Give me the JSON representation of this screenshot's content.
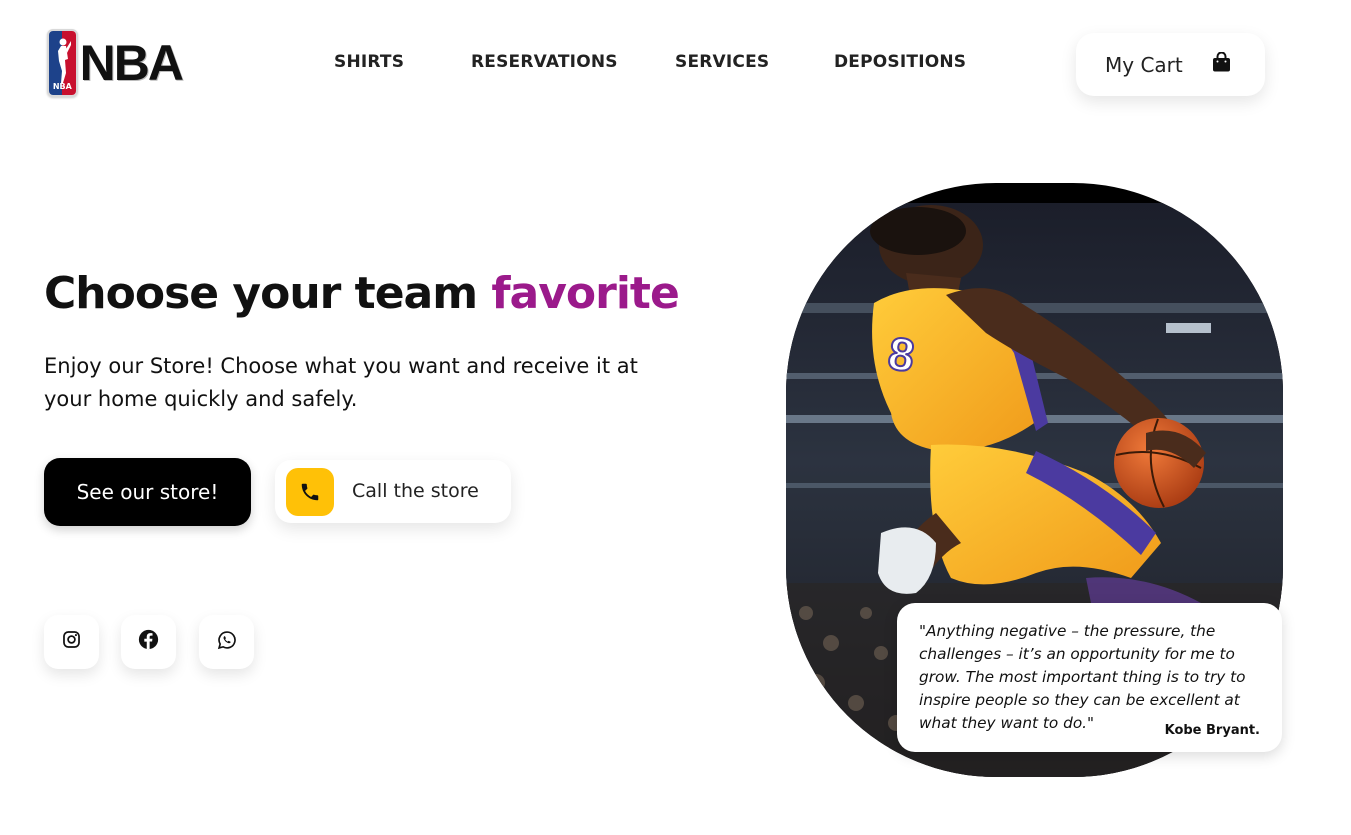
{
  "brand": {
    "logo_text": "NBA",
    "mark_text": "NBA"
  },
  "nav": {
    "items": [
      {
        "label": "SHIRTS"
      },
      {
        "label": "RESERVATIONS"
      },
      {
        "label": "SERVICES"
      },
      {
        "label": "DEPOSITIONS"
      }
    ]
  },
  "cart": {
    "label": "My Cart",
    "icon": "shopping-bag-icon"
  },
  "hero": {
    "title_main": "Choose your team ",
    "title_accent": "favorite",
    "subtitle": "Enjoy our Store! Choose what you want and receive it at your home quickly and safely.",
    "primary_button": "See our store!",
    "secondary_button": "Call the store",
    "secondary_icon": "phone-icon"
  },
  "social": [
    {
      "icon": "instagram-icon"
    },
    {
      "icon": "facebook-icon"
    },
    {
      "icon": "whatsapp-icon"
    }
  ],
  "quote": {
    "text": "\"Anything negative – the pressure, the challenges – it’s an opportunity for me to grow. The most important thing is to try to inspire people so they can be excellent at what they want to do.\"",
    "author": "Kobe Bryant."
  },
  "colors": {
    "accent": "#9b1a8b",
    "call_icon_bg": "#ffc107",
    "jersey_yellow": "#f7b52b",
    "jersey_purple": "#4b3aa0"
  }
}
